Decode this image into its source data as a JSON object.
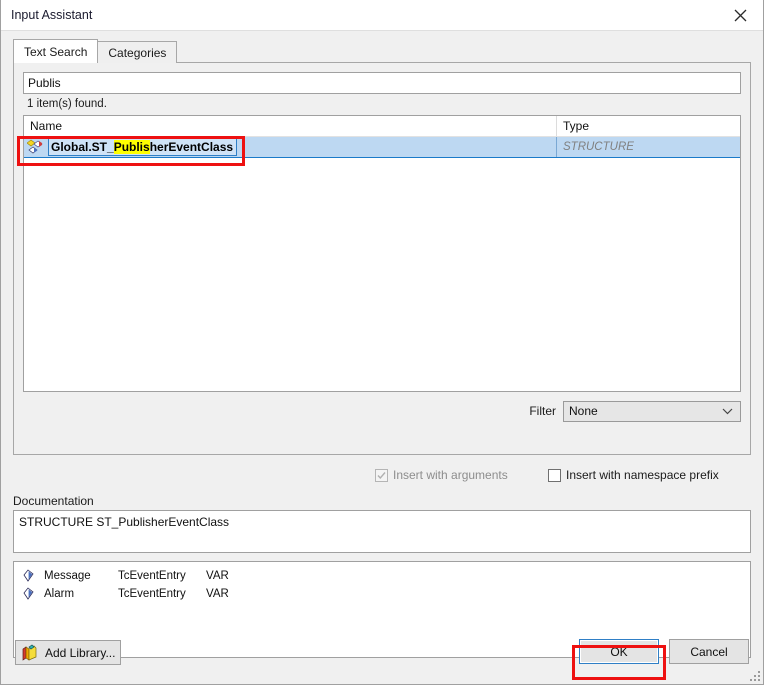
{
  "window": {
    "title": "Input Assistant",
    "close_icon": "close-icon"
  },
  "tabs": [
    {
      "label": "Text Search",
      "active": true
    },
    {
      "label": "Categories",
      "active": false
    }
  ],
  "search": {
    "value": "Publis",
    "placeholder": "",
    "result_count_text": "1 item(s) found."
  },
  "results": {
    "columns": [
      "Name",
      "Type"
    ],
    "rows": [
      {
        "icon": "structure-icon",
        "name_prefix": "Global.ST_",
        "name_highlight": "Publis",
        "name_suffix": "herEventClass",
        "full_name": "Global.ST_PublisherEventClass",
        "type": "STRUCTURE",
        "selected": true
      }
    ]
  },
  "filter": {
    "label": "Filter",
    "value": "None",
    "options": [
      "None"
    ],
    "chevron_icon": "chevron-down-icon"
  },
  "options": {
    "insert_with_arguments": {
      "label": "Insert with arguments",
      "checked": true,
      "disabled": true
    },
    "insert_with_namespace_prefix": {
      "label": "Insert with namespace prefix",
      "checked": false,
      "disabled": false
    }
  },
  "documentation": {
    "label": "Documentation",
    "text": "STRUCTURE ST_PublisherEventClass"
  },
  "members": {
    "rows": [
      {
        "icon": "variable-icon",
        "name": "Message",
        "type": "TcEventEntry",
        "scope": "VAR"
      },
      {
        "icon": "variable-icon",
        "name": "Alarm",
        "type": "TcEventEntry",
        "scope": "VAR"
      }
    ]
  },
  "footer": {
    "add_library_label": "Add Library...",
    "add_library_icon": "library-books-icon",
    "ok_label": "OK",
    "cancel_label": "Cancel"
  },
  "annotations": {
    "colors": {
      "highlight_box": "#ee1111",
      "search_match": "#ffff00",
      "selection": "#bdd8f2"
    }
  }
}
